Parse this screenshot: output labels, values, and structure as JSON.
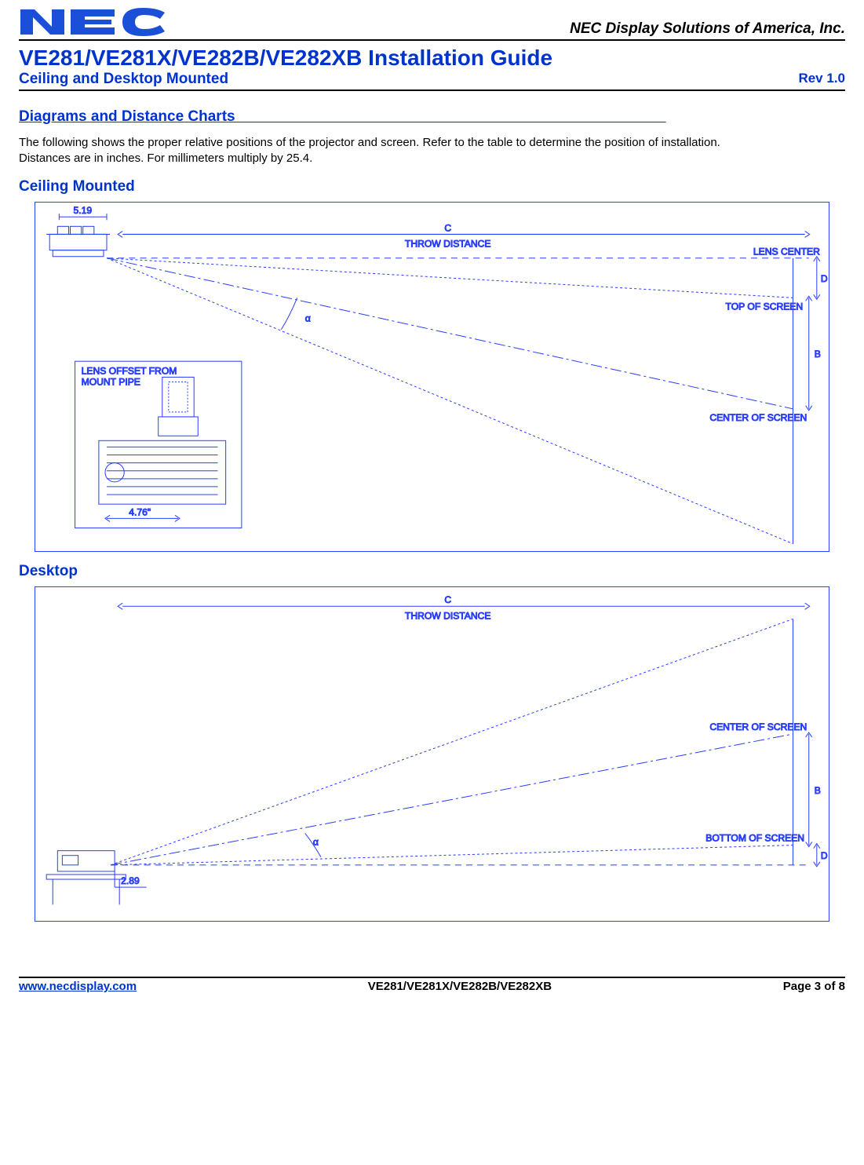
{
  "header": {
    "company": "NEC Display Solutions of America, Inc.",
    "title": "VE281/VE281X/VE282B/VE282XB Installation Guide",
    "subtitle": "Ceiling and Desktop Mounted",
    "rev": "Rev 1.0"
  },
  "section": {
    "heading": "Diagrams and Distance Charts                                                                                                        ",
    "intro1": "The following shows the proper relative positions of the projector and screen. Refer to the table to determine the position of installation.",
    "intro2": "Distances are in inches. For millimeters multiply by 25.4."
  },
  "ceiling": {
    "heading": "Ceiling Mounted",
    "labels": {
      "top_dim": "5.19",
      "throw_c": "C",
      "throw": "THROW DISTANCE",
      "lens_center": "LENS CENTER",
      "top_of_screen": "TOP OF SCREEN",
      "center_of_screen": "CENTER OF SCREEN",
      "alpha": "α",
      "dim_b": "B",
      "dim_d": "D",
      "inset_title1": "LENS OFFSET FROM",
      "inset_title2": "MOUNT PIPE",
      "inset_dim": "4.76\""
    }
  },
  "desktop": {
    "heading": "Desktop",
    "labels": {
      "throw_c": "C",
      "throw": "THROW DISTANCE",
      "center_of_screen": "CENTER OF SCREEN",
      "bottom_of_screen": "BOTTOM OF SCREEN",
      "alpha": "α",
      "dim_b": "B",
      "dim_d": "D",
      "bottom_dim": "2.89"
    }
  },
  "footer": {
    "url": "www.necdisplay.com",
    "model": "VE281/VE281X/VE282B/VE282XB",
    "page": "Page 3 of 8"
  }
}
